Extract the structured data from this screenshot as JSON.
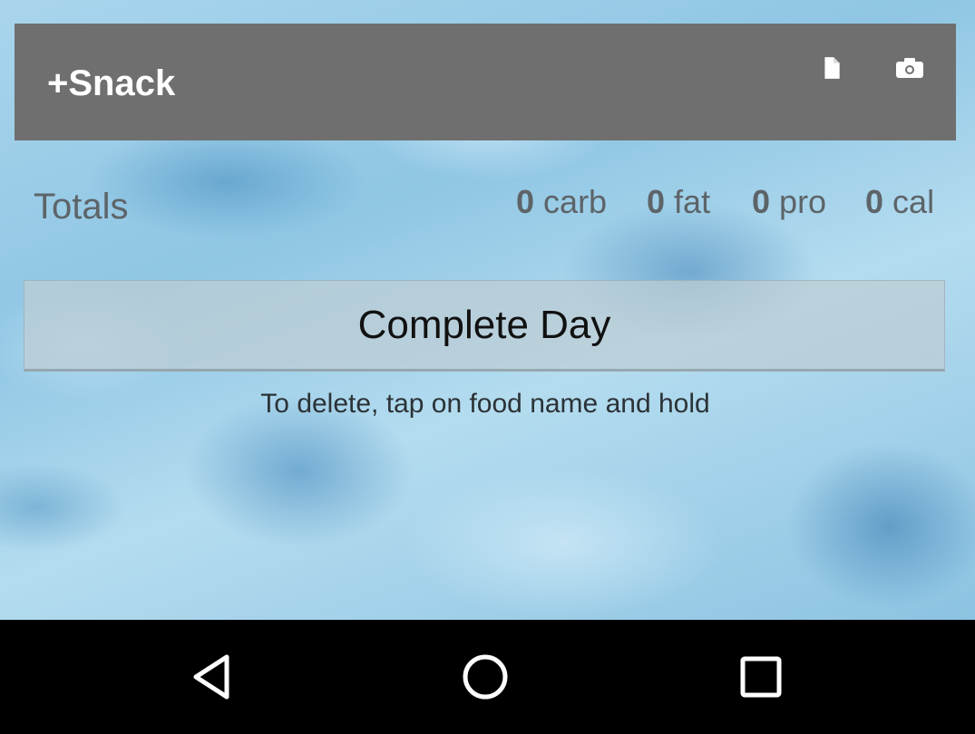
{
  "toolbar": {
    "title": "+Snack",
    "background": "#6f6f6f",
    "icons": [
      "document-icon",
      "camera-icon"
    ]
  },
  "totals": {
    "label": "Totals",
    "macros": [
      {
        "value": "0",
        "unit": "carb"
      },
      {
        "value": "0",
        "unit": "fat"
      },
      {
        "value": "0",
        "unit": "pro"
      },
      {
        "value": "0",
        "unit": "cal"
      }
    ]
  },
  "actions": {
    "complete_day_label": "Complete Day"
  },
  "hint": {
    "text": "To delete, tap on food name and hold"
  },
  "navbar": {
    "icons": [
      "back-icon",
      "home-icon",
      "recents-icon"
    ]
  }
}
